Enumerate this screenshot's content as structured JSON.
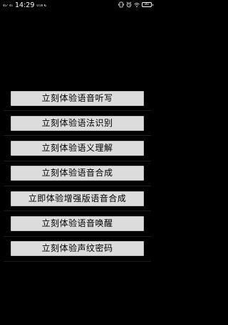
{
  "status_bar": {
    "signal_left": "4G⁺ 4G⁺",
    "time": "14:29",
    "net_speed": "0.00 K/s",
    "battery_level": "80",
    "icons": [
      "vibrate-icon",
      "alarm-icon",
      "wifi-icon",
      "battery-icon"
    ]
  },
  "menu": {
    "items": [
      {
        "label": "立刻体验语音听写"
      },
      {
        "label": "立刻体验语法识别"
      },
      {
        "label": "立刻体验语义理解"
      },
      {
        "label": "立刻体验语音合成"
      },
      {
        "label": "立即体验增强版语音合成"
      },
      {
        "label": "立刻体验语音唤醒"
      },
      {
        "label": "立刻体验声纹密码"
      }
    ]
  },
  "colors": {
    "background": "#000000",
    "button": "#dcdcdc",
    "button_text": "#000000",
    "status_text": "#ffffff"
  }
}
